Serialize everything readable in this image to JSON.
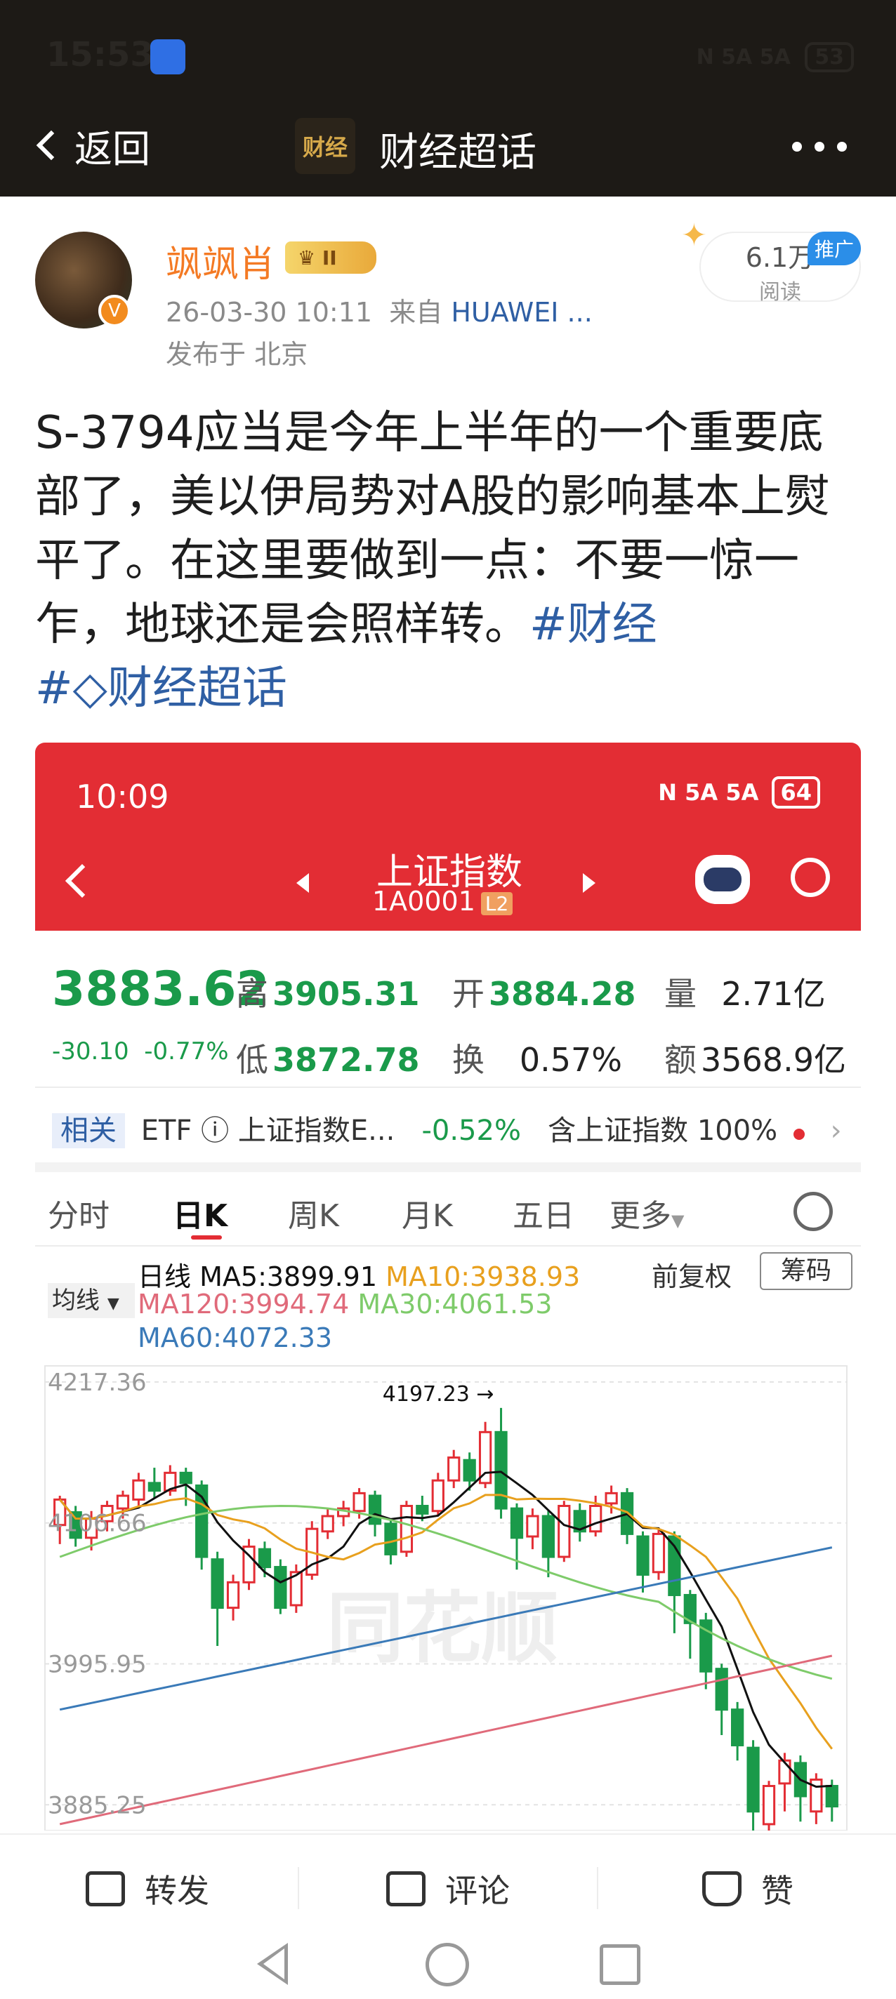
{
  "status_bar": {
    "time": "15:53",
    "icons": "N 5A 5A",
    "battery": "53"
  },
  "nav": {
    "back_label": "返回",
    "logo_text": "财经",
    "title": "财经超话"
  },
  "author": {
    "name": "飒飒肖",
    "level_badge": "II",
    "post_time": "26-03-30 10:11",
    "source_prefix": "来自",
    "source_device": "HUAWEI ...",
    "location": "发布于 北京",
    "reads": "6.1万",
    "reads_label": "阅读",
    "promo_tag": "推广"
  },
  "post": {
    "text": "S-3794应当是今年上半年的一个重要底部了，美以伊局势对A股的影响基本上熨平了。在这里要做到一点：不要一惊一乍，地球还是会照样转。",
    "tag1": "#财经",
    "tag2": "#",
    "tag2_text": "财经超话"
  },
  "embedded": {
    "time": "10:09",
    "status": "N 5A 5A",
    "battery": "64",
    "title": "上证指数",
    "code": "1A0001",
    "level": "L2",
    "quote": {
      "price": "3883.62",
      "change": "-30.10",
      "change_pct": "-0.77%",
      "high_label": "高",
      "high": "3905.31",
      "open_label": "开",
      "open": "3884.28",
      "vol_label": "量",
      "vol": "2.71亿",
      "low_label": "低",
      "low": "3872.78",
      "turn_label": "换",
      "turn": "0.57%",
      "amt_label": "额",
      "amt": "3568.9亿"
    },
    "related": {
      "chip": "相关",
      "etf": "ETF",
      "name": "上证指数E...",
      "pct": "-0.52%",
      "contains": "含上证指数 100%"
    },
    "tabs": [
      "分时",
      "日K",
      "周K",
      "月K",
      "五日",
      "更多"
    ],
    "ma": {
      "label": "日线",
      "ma5": "MA5:3899.91",
      "ma10": "MA10:3938.93",
      "ma120": "MA120:3994.74",
      "ma30": "MA30:4061.53",
      "ma60": "MA60:4072.33",
      "junxian": "均线",
      "fq": "前复权",
      "chouma": "筹码"
    },
    "watermark": "同花顺",
    "colors": {
      "up": "#e32d34",
      "down": "#1a9a4a",
      "ma5": "#111111",
      "ma10": "#e8a01e",
      "ma30": "#7ecb6a",
      "ma60": "#3a7ab8",
      "ma120": "#e06a7a"
    }
  },
  "chart_data": {
    "type": "candlestick",
    "y_ticks": [
      "4217.36",
      "4106.66",
      "3995.95",
      "3885.25"
    ],
    "high_marker": "4197.23",
    "ylim": [
      3865,
      4230
    ],
    "candles": [
      [
        4105,
        4125,
        4090,
        4128
      ],
      [
        4115,
        4095,
        4088,
        4120
      ],
      [
        4095,
        4110,
        4085,
        4116
      ],
      [
        4108,
        4120,
        4100,
        4124
      ],
      [
        4118,
        4128,
        4110,
        4132
      ],
      [
        4125,
        4140,
        4118,
        4146
      ],
      [
        4138,
        4132,
        4126,
        4150
      ],
      [
        4132,
        4146,
        4128,
        4152
      ],
      [
        4146,
        4138,
        4120,
        4150
      ],
      [
        4136,
        4080,
        4070,
        4140
      ],
      [
        4078,
        4040,
        4010,
        4084
      ],
      [
        4040,
        4060,
        4030,
        4066
      ],
      [
        4060,
        4088,
        4054,
        4094
      ],
      [
        4086,
        4072,
        4064,
        4092
      ],
      [
        4072,
        4040,
        4035,
        4078
      ],
      [
        4042,
        4068,
        4036,
        4074
      ],
      [
        4066,
        4102,
        4062,
        4108
      ],
      [
        4100,
        4112,
        4094,
        4118
      ],
      [
        4112,
        4118,
        4104,
        4124
      ],
      [
        4116,
        4130,
        4110,
        4134
      ],
      [
        4128,
        4106,
        4096,
        4132
      ],
      [
        4106,
        4082,
        4074,
        4110
      ],
      [
        4084,
        4120,
        4080,
        4124
      ],
      [
        4120,
        4114,
        4108,
        4128
      ],
      [
        4116,
        4140,
        4112,
        4146
      ],
      [
        4140,
        4158,
        4134,
        4164
      ],
      [
        4156,
        4140,
        4132,
        4162
      ],
      [
        4138,
        4178,
        4134,
        4186
      ],
      [
        4178,
        4118,
        4110,
        4197
      ],
      [
        4118,
        4095,
        4070,
        4122
      ],
      [
        4096,
        4112,
        4086,
        4118
      ],
      [
        4112,
        4080,
        4064,
        4116
      ],
      [
        4080,
        4120,
        4076,
        4124
      ],
      [
        4116,
        4100,
        4092,
        4122
      ],
      [
        4100,
        4120,
        4096,
        4128
      ],
      [
        4122,
        4130,
        4114,
        4136
      ],
      [
        4130,
        4098,
        4090,
        4134
      ],
      [
        4096,
        4066,
        4052,
        4100
      ],
      [
        4068,
        4098,
        4062,
        4102
      ],
      [
        4096,
        4050,
        4020,
        4100
      ],
      [
        4050,
        4028,
        4000,
        4054
      ],
      [
        4030,
        3990,
        3976,
        4036
      ],
      [
        3992,
        3960,
        3940,
        3996
      ],
      [
        3960,
        3932,
        3920,
        3966
      ],
      [
        3930,
        3880,
        3860,
        3936
      ],
      [
        3870,
        3900,
        3864,
        3904
      ],
      [
        3902,
        3920,
        3880,
        3926
      ],
      [
        3918,
        3892,
        3872,
        3924
      ],
      [
        3880,
        3905,
        3870,
        3910
      ],
      [
        3900,
        3884,
        3872,
        3905
      ]
    ]
  },
  "actions": {
    "repost": "转发",
    "comment": "评论",
    "like": "赞"
  }
}
